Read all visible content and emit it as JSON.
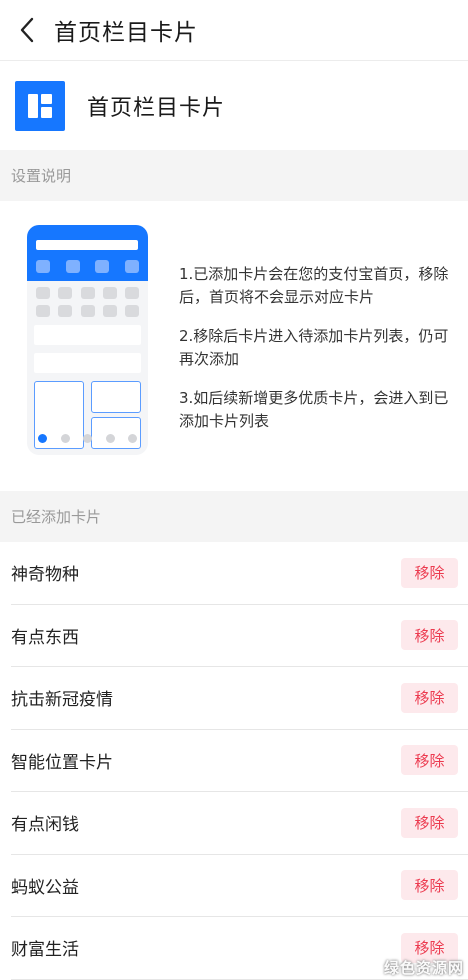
{
  "nav": {
    "title": "首页栏目卡片",
    "back_icon": "chevron-left-icon"
  },
  "header": {
    "title": "首页栏目卡片",
    "icon": "layout-cards-icon",
    "icon_color": "#1677ff"
  },
  "settings": {
    "section_title": "设置说明",
    "illustration": "phone-home-preview",
    "lines": [
      "1.已添加卡片会在您的支付宝首页，移除后，首页将不会显示对应卡片",
      "2.移除后卡片进入待添加卡片列表，仍可再次添加",
      "3.如后续新增更多优质卡片，会进入到已添加卡片列表"
    ]
  },
  "added": {
    "section_title": "已经添加卡片",
    "items": [
      {
        "name": "神奇物种",
        "action": "移除"
      },
      {
        "name": "有点东西",
        "action": "移除"
      },
      {
        "name": "抗击新冠疫情",
        "action": "移除"
      },
      {
        "name": "智能位置卡片",
        "action": "移除"
      },
      {
        "name": "有点闲钱",
        "action": "移除"
      },
      {
        "name": "蚂蚁公益",
        "action": "移除"
      },
      {
        "name": "财富生活",
        "action": "移除"
      }
    ]
  },
  "watermark": "绿色资源网",
  "colors": {
    "accent": "#1677ff",
    "remove_text": "#ec3a4f",
    "remove_bg": "#fde9ec",
    "section_bg": "#f4f4f4"
  }
}
